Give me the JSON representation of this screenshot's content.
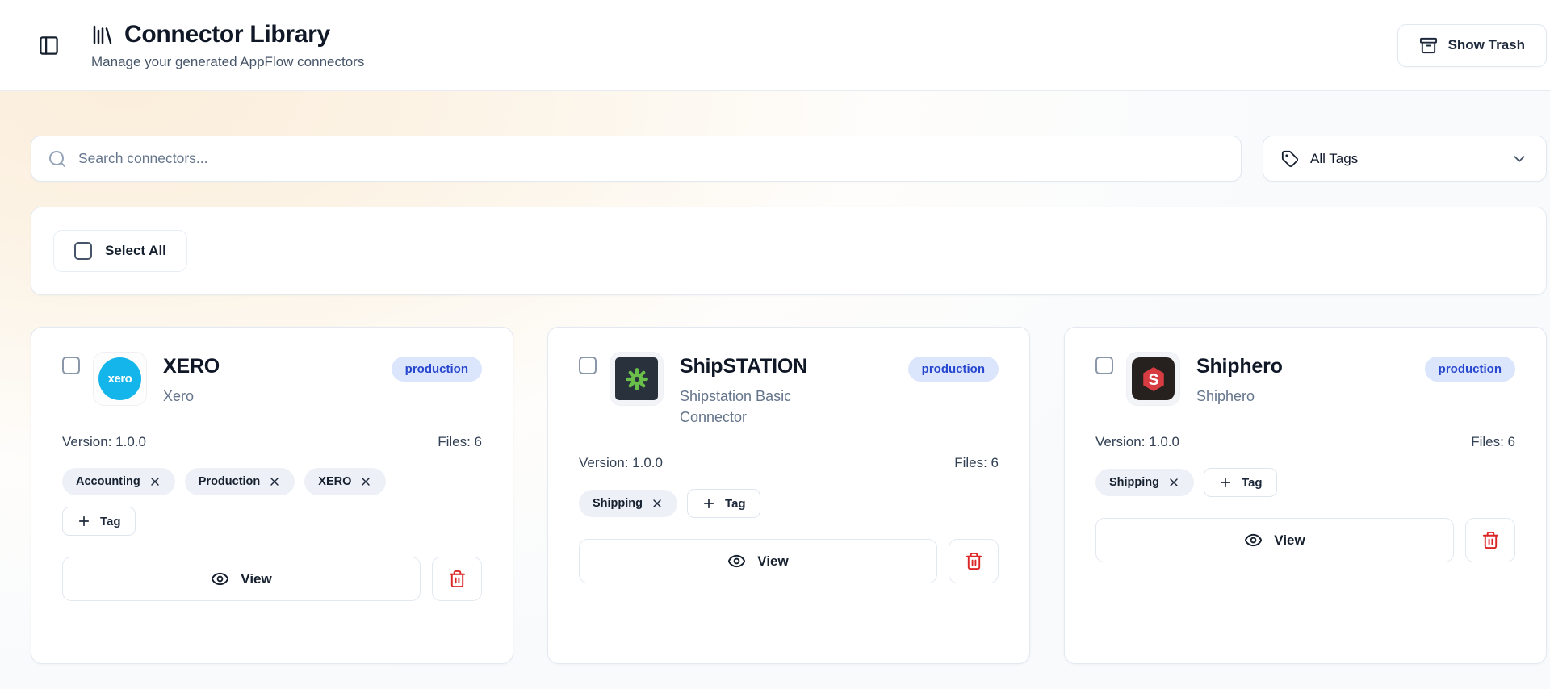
{
  "header": {
    "title": "Connector Library",
    "subtitle": "Manage your generated AppFlow connectors",
    "show_trash_label": "Show Trash"
  },
  "toolbar": {
    "search_placeholder": "Search connectors...",
    "tags_filter_label": "All Tags"
  },
  "selection": {
    "select_all_label": "Select All"
  },
  "cards": [
    {
      "title": "XERO",
      "subtitle": "Xero",
      "badge": "production",
      "version_label": "Version: 1.0.0",
      "files_label": "Files: 6",
      "tags": [
        "Accounting",
        "Production",
        "XERO"
      ],
      "add_tag_label": "Tag",
      "view_label": "View",
      "logo_text": "xero"
    },
    {
      "title": "ShipSTATION",
      "subtitle": "Shipstation Basic Connector",
      "badge": "production",
      "version_label": "Version: 1.0.0",
      "files_label": "Files: 6",
      "tags": [
        "Shipping"
      ],
      "add_tag_label": "Tag",
      "view_label": "View"
    },
    {
      "title": "Shiphero",
      "subtitle": "Shiphero",
      "badge": "production",
      "version_label": "Version: 1.0.0",
      "files_label": "Files: 6",
      "tags": [
        "Shipping"
      ],
      "add_tag_label": "Tag",
      "view_label": "View",
      "logo_letter": "S"
    }
  ],
  "colors": {
    "badge_bg": "#dbe5fb",
    "badge_text": "#2747cf",
    "danger": "#dc2626",
    "xero_teal": "#13b5ea",
    "shipstation_green": "#6abf4b",
    "shiphero_red": "#d63c41",
    "header_gradient_warm": "#fbeedc"
  }
}
